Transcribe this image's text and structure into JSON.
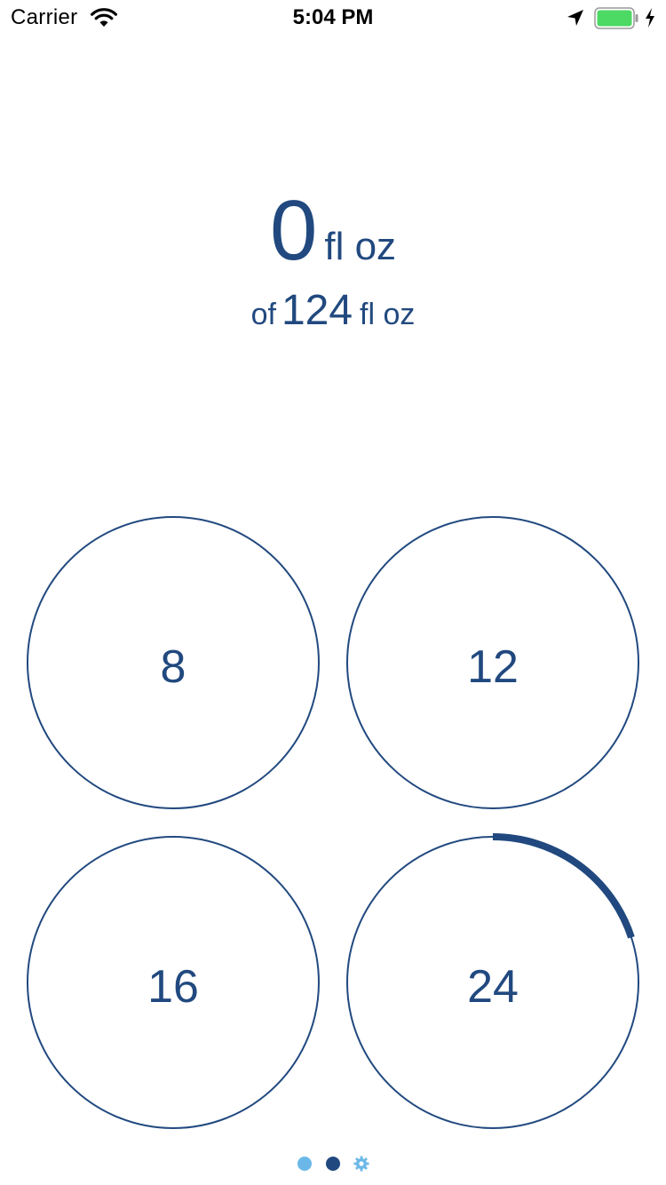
{
  "status_bar": {
    "carrier": "Carrier",
    "time": "5:04 PM",
    "battery_color": "#4cd964"
  },
  "intake": {
    "current_value": "0",
    "current_unit": "fl oz",
    "goal_prefix": "of",
    "goal_value": "124",
    "goal_unit": "fl oz"
  },
  "quick_add_buttons": [
    {
      "label": "8",
      "progress": 0
    },
    {
      "label": "12",
      "progress": 0
    },
    {
      "label": "16",
      "progress": 0
    },
    {
      "label": "24",
      "progress": 0.2
    }
  ],
  "page_indicator": {
    "pages": [
      {
        "name": "page-1",
        "active": false
      },
      {
        "name": "page-2",
        "active": true
      },
      {
        "name": "settings",
        "icon": "gear-icon"
      }
    ],
    "active_color": "#21497f",
    "inactive_color": "#6bb8e8"
  },
  "colors": {
    "accent": "#21497f"
  }
}
